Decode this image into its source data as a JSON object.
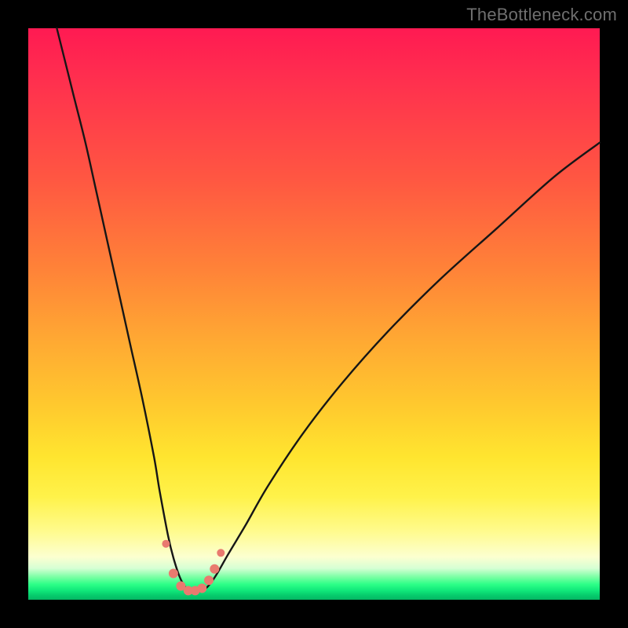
{
  "watermark": "TheBottleneck.com",
  "gradient_colors": {
    "top": "#ff1a52",
    "mid_upper": "#ff8238",
    "mid": "#ffe52f",
    "pale": "#fcffd0",
    "green": "#05b864"
  },
  "chart_data": {
    "type": "line",
    "title": "",
    "xlabel": "",
    "ylabel": "",
    "xlim": [
      0,
      100
    ],
    "ylim": [
      0,
      100
    ],
    "series": [
      {
        "name": "bottleneck-curve",
        "x": [
          5,
          8,
          10,
          12,
          14,
          16,
          18,
          20,
          22,
          23,
          24.5,
          25.5,
          26.5,
          27.5,
          28.5,
          29.5,
          30.5,
          31.5,
          33,
          35,
          38,
          42,
          48,
          55,
          63,
          72,
          82,
          92,
          100
        ],
        "y": [
          100,
          88,
          80,
          71,
          62,
          53,
          44,
          35,
          25,
          19,
          11,
          7,
          4,
          2.2,
          1.6,
          1.4,
          1.6,
          2.4,
          4.5,
          8,
          13,
          20,
          29,
          38,
          47,
          56,
          65,
          74,
          80
        ]
      }
    ],
    "markers": {
      "name": "highlight-points",
      "color": "#e97a6f",
      "points": [
        {
          "x": 24.1,
          "y": 9.8,
          "r": 5
        },
        {
          "x": 25.4,
          "y": 4.6,
          "r": 6
        },
        {
          "x": 26.7,
          "y": 2.4,
          "r": 6
        },
        {
          "x": 28.0,
          "y": 1.6,
          "r": 6
        },
        {
          "x": 29.2,
          "y": 1.6,
          "r": 6
        },
        {
          "x": 30.4,
          "y": 2.0,
          "r": 6
        },
        {
          "x": 31.6,
          "y": 3.4,
          "r": 6
        },
        {
          "x": 32.6,
          "y": 5.4,
          "r": 6
        },
        {
          "x": 33.7,
          "y": 8.2,
          "r": 5
        }
      ]
    }
  }
}
